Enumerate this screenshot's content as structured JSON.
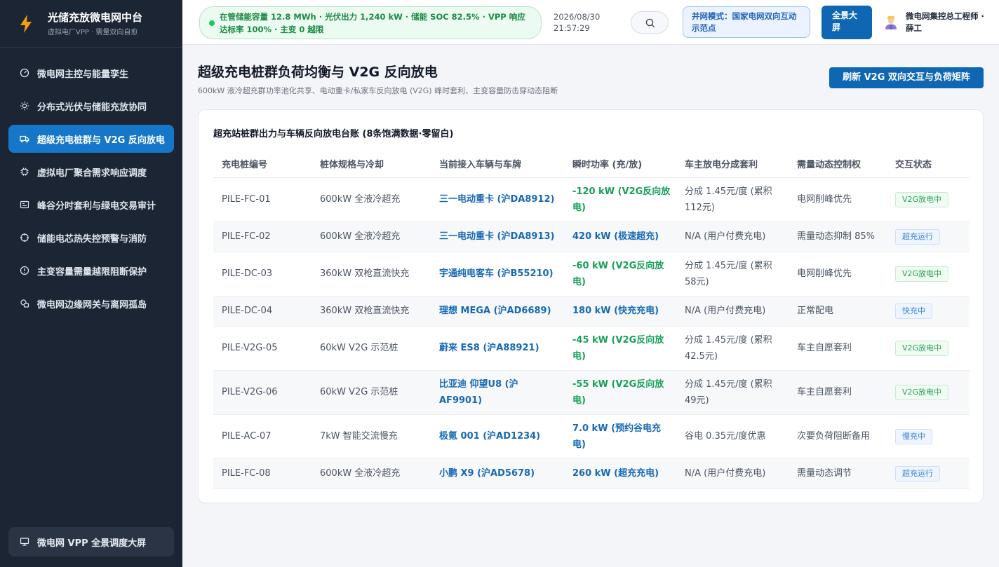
{
  "brand": {
    "title": "光储充放微电网中台",
    "subtitle": "虚拟电厂VPP · 需量双向自愈"
  },
  "sidebar": {
    "items": [
      {
        "label": "微电网主控与能量孪生",
        "icon": "dashboard-gauge-icon",
        "active": false
      },
      {
        "label": "分布式光伏与储能充放协同",
        "icon": "sun-icon",
        "active": false
      },
      {
        "label": "超级充电桩群与 V2G 反向放电",
        "icon": "truck-icon",
        "active": true
      },
      {
        "label": "虚拟电厂聚合需求响应调度",
        "icon": "chip-icon",
        "active": false
      },
      {
        "label": "峰谷分时套利与绿电交易审计",
        "icon": "ledger-icon",
        "active": false
      },
      {
        "label": "储能电芯热失控预警与消防",
        "icon": "crosshair-icon",
        "active": false
      },
      {
        "label": "主变容量需量越限阻断保护",
        "icon": "alert-circle-icon",
        "active": false
      },
      {
        "label": "微电网边缘网关与离网孤岛",
        "icon": "gateway-icon",
        "active": false
      }
    ],
    "bottom_button": "微电网 VPP 全景调度大屏"
  },
  "header": {
    "status_text": "在管储能容量 12.8 MWh · 光伏出力 1,240 kW · 储能 SOC 82.5% · VPP 响应达标率 100% · 主变 0 越限",
    "date": "2026/08/30",
    "time": "21:57:29",
    "mode_badge": "并网模式：国家电网双向互动示范点",
    "full_screen_button": "全景大屏",
    "user_name": "微电网集控总工程师 · 薛工"
  },
  "page": {
    "title": "超级充电桩群负荷均衡与 V2G 反向放电",
    "subtitle": "600kW 液冷超充群功率池化共享、电动重卡/私家车反向放电 (V2G) 峰时套利、主变容量防击穿动态阻断",
    "refresh_button": "刷新 V2G 双向交互与负荷矩阵"
  },
  "table": {
    "title": "超充站桩群出力与车辆反向放电台账 (8条饱满数据·零留白)",
    "headers": [
      "充电桩编号",
      "桩体规格与冷却",
      "当前接入车辆与车牌",
      "瞬时功率 (充/放)",
      "车主放电分成套利",
      "需量动态控制权",
      "交互状态"
    ],
    "rows": [
      {
        "id": "PILE-FC-01",
        "spec": "600kW 全液冷超充",
        "vehicle": "三一电动重卡 (沪DA8912)",
        "power": "-120 kW (V2G反向放电)",
        "power_type": "discharge",
        "revenue": "分成 1.45元/度 (累积 112元)",
        "control": "电网削峰优先",
        "status": "V2G放电中",
        "status_color": "green"
      },
      {
        "id": "PILE-FC-02",
        "spec": "600kW 全液冷超充",
        "vehicle": "三一电动重卡 (沪DA8913)",
        "power": "420 kW (极速超充)",
        "power_type": "charge",
        "revenue": "N/A (用户付费充电)",
        "control": "需量动态抑制 85%",
        "status": "超充运行",
        "status_color": "blue"
      },
      {
        "id": "PILE-DC-03",
        "spec": "360kW 双枪直流快充",
        "vehicle": "宇通纯电客车 (沪B55210)",
        "power": "-60 kW (V2G反向放电)",
        "power_type": "discharge",
        "revenue": "分成 1.45元/度 (累积 58元)",
        "control": "电网削峰优先",
        "status": "V2G放电中",
        "status_color": "green"
      },
      {
        "id": "PILE-DC-04",
        "spec": "360kW 双枪直流快充",
        "vehicle": "理想 MEGA (沪AD6689)",
        "power": "180 kW (快充充电)",
        "power_type": "charge",
        "revenue": "N/A (用户付费充电)",
        "control": "正常配电",
        "status": "快充中",
        "status_color": "blue"
      },
      {
        "id": "PILE-V2G-05",
        "spec": "60kW V2G 示范桩",
        "vehicle": "蔚来 ES8 (沪A88921)",
        "power": "-45 kW (V2G反向放电)",
        "power_type": "discharge",
        "revenue": "分成 1.45元/度 (累积 42.5元)",
        "control": "车主自愿套利",
        "status": "V2G放电中",
        "status_color": "green"
      },
      {
        "id": "PILE-V2G-06",
        "spec": "60kW V2G 示范桩",
        "vehicle": "比亚迪 仰望U8 (沪AF9901)",
        "power": "-55 kW (V2G反向放电)",
        "power_type": "discharge",
        "revenue": "分成 1.45元/度 (累积 49元)",
        "control": "车主自愿套利",
        "status": "V2G放电中",
        "status_color": "green"
      },
      {
        "id": "PILE-AC-07",
        "spec": "7kW 智能交流慢充",
        "vehicle": "极氪 001 (沪AD1234)",
        "power": "7.0 kW (预约谷电充电)",
        "power_type": "charge",
        "revenue": "谷电 0.35元/度优惠",
        "control": "次要负荷阻断备用",
        "status": "慢充中",
        "status_color": "blue"
      },
      {
        "id": "PILE-FC-08",
        "spec": "600kW 全液冷超充",
        "vehicle": "小鹏 X9 (沪AD5678)",
        "power": "260 kW (超充充电)",
        "power_type": "charge",
        "revenue": "N/A (用户付费充电)",
        "control": "需量动态调节",
        "status": "超充运行",
        "status_color": "blue"
      }
    ]
  },
  "colors": {
    "sidebar_bg": "#1c2533",
    "accent": "#1677c9",
    "primary_button": "#0f67b3",
    "discharge_green": "#18a058",
    "charge_blue": "#1769b5",
    "status_pill_green": "#1c8a45"
  }
}
